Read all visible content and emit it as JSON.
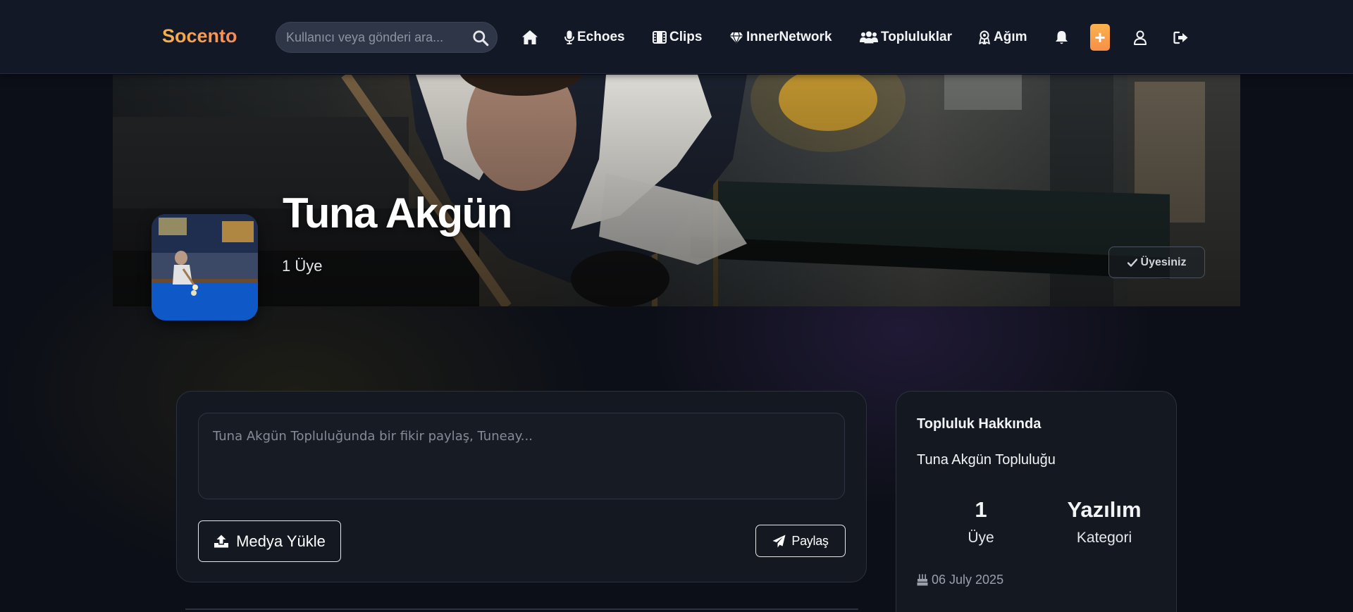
{
  "navbar": {
    "brand": "Socento",
    "search_placeholder": "Kullanıcı veya gönderi ara...",
    "items": [
      {
        "label": "Echoes",
        "icon": "microphone-icon"
      },
      {
        "label": "Clips",
        "icon": "film-icon"
      },
      {
        "label": "InnerNetwork",
        "icon": "gem-icon"
      },
      {
        "label": "Topluluklar",
        "icon": "users-icon"
      },
      {
        "label": "Ağım",
        "icon": "network-icon"
      }
    ],
    "plus_label": "+",
    "icons": [
      "home-icon",
      "bell-icon",
      "plus-icon",
      "user-icon",
      "logout-icon"
    ],
    "accent_color": "#f6a54a"
  },
  "community": {
    "name": "Tuna Akgün",
    "member_count_text": "1 Üye",
    "membership_label": "Üyesiniz"
  },
  "composer": {
    "placeholder": "Tuna Akgün Topluluğunda bir fikir paylaş, Tuneay...",
    "upload_label": "Medya Yükle",
    "share_label": "Paylaş"
  },
  "about": {
    "title": "Topluluk Hakkında",
    "description": "Tuna Akgün Topluluğu",
    "stats": [
      {
        "value": "1",
        "label": "Üye"
      },
      {
        "value": "Yazılım",
        "label": "Kategori"
      }
    ],
    "created_date": "06 July 2025"
  }
}
